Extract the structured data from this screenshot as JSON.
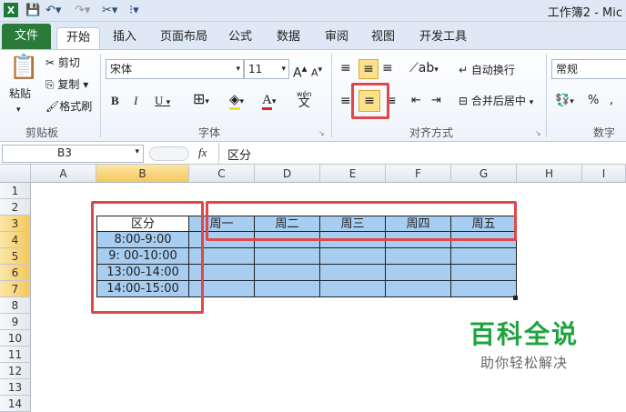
{
  "window": {
    "title": "工作簿2 - Mic"
  },
  "tabs": [
    "文件",
    "开始",
    "插入",
    "页面布局",
    "公式",
    "数据",
    "审阅",
    "视图",
    "开发工具"
  ],
  "clipboard": {
    "paste": "粘贴",
    "cut": "剪切",
    "copy": "复制",
    "format_painter": "格式刷",
    "group": "剪贴板"
  },
  "font": {
    "name": "宋体",
    "size": "11",
    "bold": "B",
    "italic": "I",
    "underline": "U",
    "grow": "A",
    "shrink": "A",
    "group": "字体",
    "wen": "wén",
    "wen_char": "文"
  },
  "alignment": {
    "wrap_text": "自动换行",
    "merge_center": "合并后居中",
    "group": "对齐方式"
  },
  "number": {
    "format": "常规",
    "percent": "%",
    "group": "数字"
  },
  "formula_bar": {
    "name_box": "B3",
    "fx": "fx",
    "content": "区分"
  },
  "columns": [
    "A",
    "B",
    "C",
    "D",
    "E",
    "F",
    "G",
    "H",
    "I"
  ],
  "rows": [
    "1",
    "2",
    "3",
    "4",
    "5",
    "6",
    "7",
    "8",
    "9",
    "10",
    "11",
    "12",
    "13",
    "14"
  ],
  "sheet": {
    "B3": "区分",
    "B4": "8:00-9:00",
    "B5": "9: 00-10:00",
    "B6": "13:00-14:00",
    "B7": "14:00-15:00",
    "C3": "周一",
    "D3": "周二",
    "E3": "周三",
    "F3": "周四",
    "G3": "周五"
  },
  "watermark": {
    "title": "百科全说",
    "subtitle": "助你轻松解决"
  },
  "colors": {
    "file_tab": "#2a7a3a",
    "cell_fill": "#a7cdf0",
    "highlight": "#e04848",
    "watermark": "#1fa33f"
  }
}
